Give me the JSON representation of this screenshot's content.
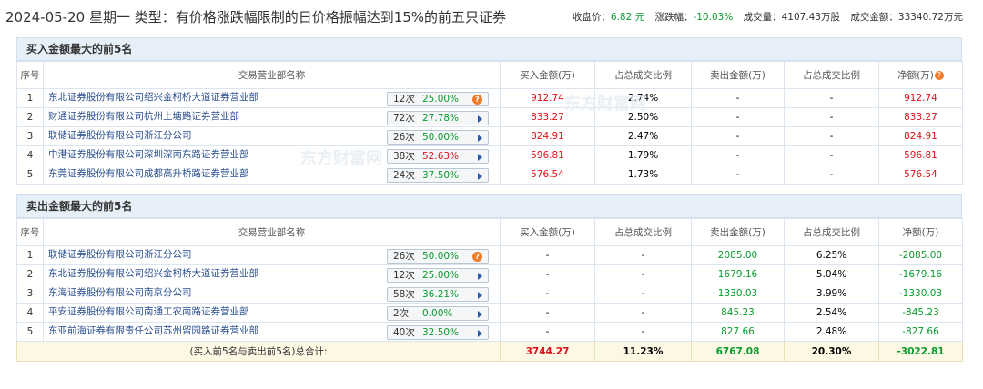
{
  "header": {
    "title": "2024-05-20 星期一 类型：有价格涨跌幅限制的日价格振幅达到15%的前五只证券",
    "close_label": "收盘价：",
    "close_value": "6.82 元",
    "change_label": "涨跌幅：",
    "change_value": "-10.03%",
    "volume_label": "成交量：",
    "volume_value": "4107.43万股",
    "amount_label": "成交金额：",
    "amount_value": "33340.72万元"
  },
  "buy_section": {
    "title": "买入金额最大的前5名",
    "columns": [
      "序号",
      "交易营业部名称",
      "买入金额(万)",
      "占总成交比例",
      "卖出金额(万)",
      "占总成交比例",
      "净额(万)"
    ],
    "help_icon": "question-icon",
    "rows": [
      {
        "seq": "1",
        "name": "东北证券股份有限公司绍兴金柯桥大道证券营业部",
        "count": "12次",
        "pct": "25.00%",
        "icon": "info-icon",
        "buy": "912.74",
        "buy_ratio": "2.74%",
        "sell": "-",
        "sell_ratio": "-",
        "net": "912.74"
      },
      {
        "seq": "2",
        "name": "财通证券股份有限公司杭州上塘路证券营业部",
        "count": "72次",
        "pct": "27.78%",
        "icon": "arrow-icon",
        "buy": "833.27",
        "buy_ratio": "2.50%",
        "sell": "-",
        "sell_ratio": "-",
        "net": "833.27"
      },
      {
        "seq": "3",
        "name": "联储证券股份有限公司浙江分公司",
        "count": "26次",
        "pct": "50.00%",
        "icon": "arrow-icon",
        "buy": "824.91",
        "buy_ratio": "2.47%",
        "sell": "-",
        "sell_ratio": "-",
        "net": "824.91"
      },
      {
        "seq": "4",
        "name": "中港证券股份有限公司深圳深南东路证券营业部",
        "count": "38次",
        "pct": "52.63%",
        "icon": "arrow-icon",
        "buy": "596.81",
        "buy_ratio": "1.79%",
        "sell": "-",
        "sell_ratio": "-",
        "net": "596.81"
      },
      {
        "seq": "5",
        "name": "东莞证券股份有限公司成都高升桥路证券营业部",
        "count": "24次",
        "pct": "37.50%",
        "icon": "arrow-icon",
        "buy": "576.54",
        "buy_ratio": "1.73%",
        "sell": "-",
        "sell_ratio": "-",
        "net": "576.54"
      }
    ]
  },
  "sell_section": {
    "title": "卖出金额最大的前5名",
    "columns": [
      "序号",
      "交易营业部名称",
      "买入金额(万)",
      "占总成交比例",
      "卖出金额(万)",
      "占总成交比例",
      "净额(万)"
    ],
    "rows": [
      {
        "seq": "1",
        "name": "联储证券股份有限公司浙江分公司",
        "count": "26次",
        "pct": "50.00%",
        "icon": "info-icon",
        "buy": "-",
        "buy_ratio": "-",
        "sell": "2085.00",
        "sell_ratio": "6.25%",
        "net": "-2085.00"
      },
      {
        "seq": "2",
        "name": "东北证券股份有限公司绍兴金柯桥大道证券营业部",
        "count": "12次",
        "pct": "25.00%",
        "icon": "arrow-icon",
        "buy": "-",
        "buy_ratio": "-",
        "sell": "1679.16",
        "sell_ratio": "5.04%",
        "net": "-1679.16"
      },
      {
        "seq": "3",
        "name": "东海证券股份有限公司南京分公司",
        "count": "58次",
        "pct": "36.21%",
        "icon": "arrow-icon",
        "buy": "-",
        "buy_ratio": "-",
        "sell": "1330.03",
        "sell_ratio": "3.99%",
        "net": "-1330.03"
      },
      {
        "seq": "4",
        "name": "平安证券股份有限公司南通工农南路证券营业部",
        "count": "2次",
        "pct": "0.00%",
        "icon": "arrow-icon",
        "buy": "-",
        "buy_ratio": "-",
        "sell": "845.23",
        "sell_ratio": "2.54%",
        "net": "-845.23"
      },
      {
        "seq": "5",
        "name": "东亚前海证券有限责任公司苏州留园路证券营业部",
        "count": "40次",
        "pct": "32.50%",
        "icon": "arrow-icon",
        "buy": "-",
        "buy_ratio": "-",
        "sell": "827.66",
        "sell_ratio": "2.48%",
        "net": "-827.66"
      }
    ],
    "total": {
      "label": "(买入前5名与卖出前5名)总合计:",
      "buy": "3744.27",
      "buy_ratio": "11.23%",
      "sell": "6767.08",
      "sell_ratio": "20.30%",
      "net": "-3022.81"
    }
  },
  "colors": {
    "red": "#e0101a",
    "green": "#0a9b2e",
    "link": "#2a4f8f",
    "section_bg": "#e7f0f9",
    "total_bg": "#fdf8e4",
    "icon_orange": "#f07c2a"
  },
  "watermark": {
    "logo_text": "东方财富网",
    "url_text": "eastmoney.com"
  }
}
